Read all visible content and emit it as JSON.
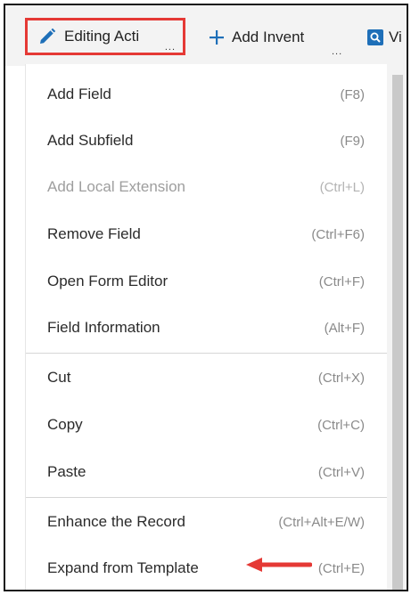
{
  "toolbar": {
    "editing_label": "Editing Acti",
    "editing_ellipsis": "...",
    "add_label": "Add Invent",
    "add_ellipsis": "...",
    "view_label": "Vi"
  },
  "menu": {
    "items": [
      {
        "label": "Add Field",
        "shortcut": "(F8)"
      },
      {
        "label": "Add Subfield",
        "shortcut": "(F9)"
      },
      {
        "label": "Add Local Extension",
        "shortcut": "(Ctrl+L)"
      },
      {
        "label": "Remove Field",
        "shortcut": "(Ctrl+F6)"
      },
      {
        "label": "Open Form Editor",
        "shortcut": "(Ctrl+F)"
      },
      {
        "label": "Field Information",
        "shortcut": "(Alt+F)"
      },
      {
        "label": "Cut",
        "shortcut": "(Ctrl+X)"
      },
      {
        "label": "Copy",
        "shortcut": "(Ctrl+C)"
      },
      {
        "label": "Paste",
        "shortcut": "(Ctrl+V)"
      },
      {
        "label": "Enhance the Record",
        "shortcut": "(Ctrl+Alt+E/W)"
      },
      {
        "label": "Expand from Template",
        "shortcut": "(Ctrl+E)"
      }
    ]
  },
  "colors": {
    "highlight_border": "#e53935",
    "arrow": "#e53935",
    "accent_blue": "#1e6fb8"
  }
}
